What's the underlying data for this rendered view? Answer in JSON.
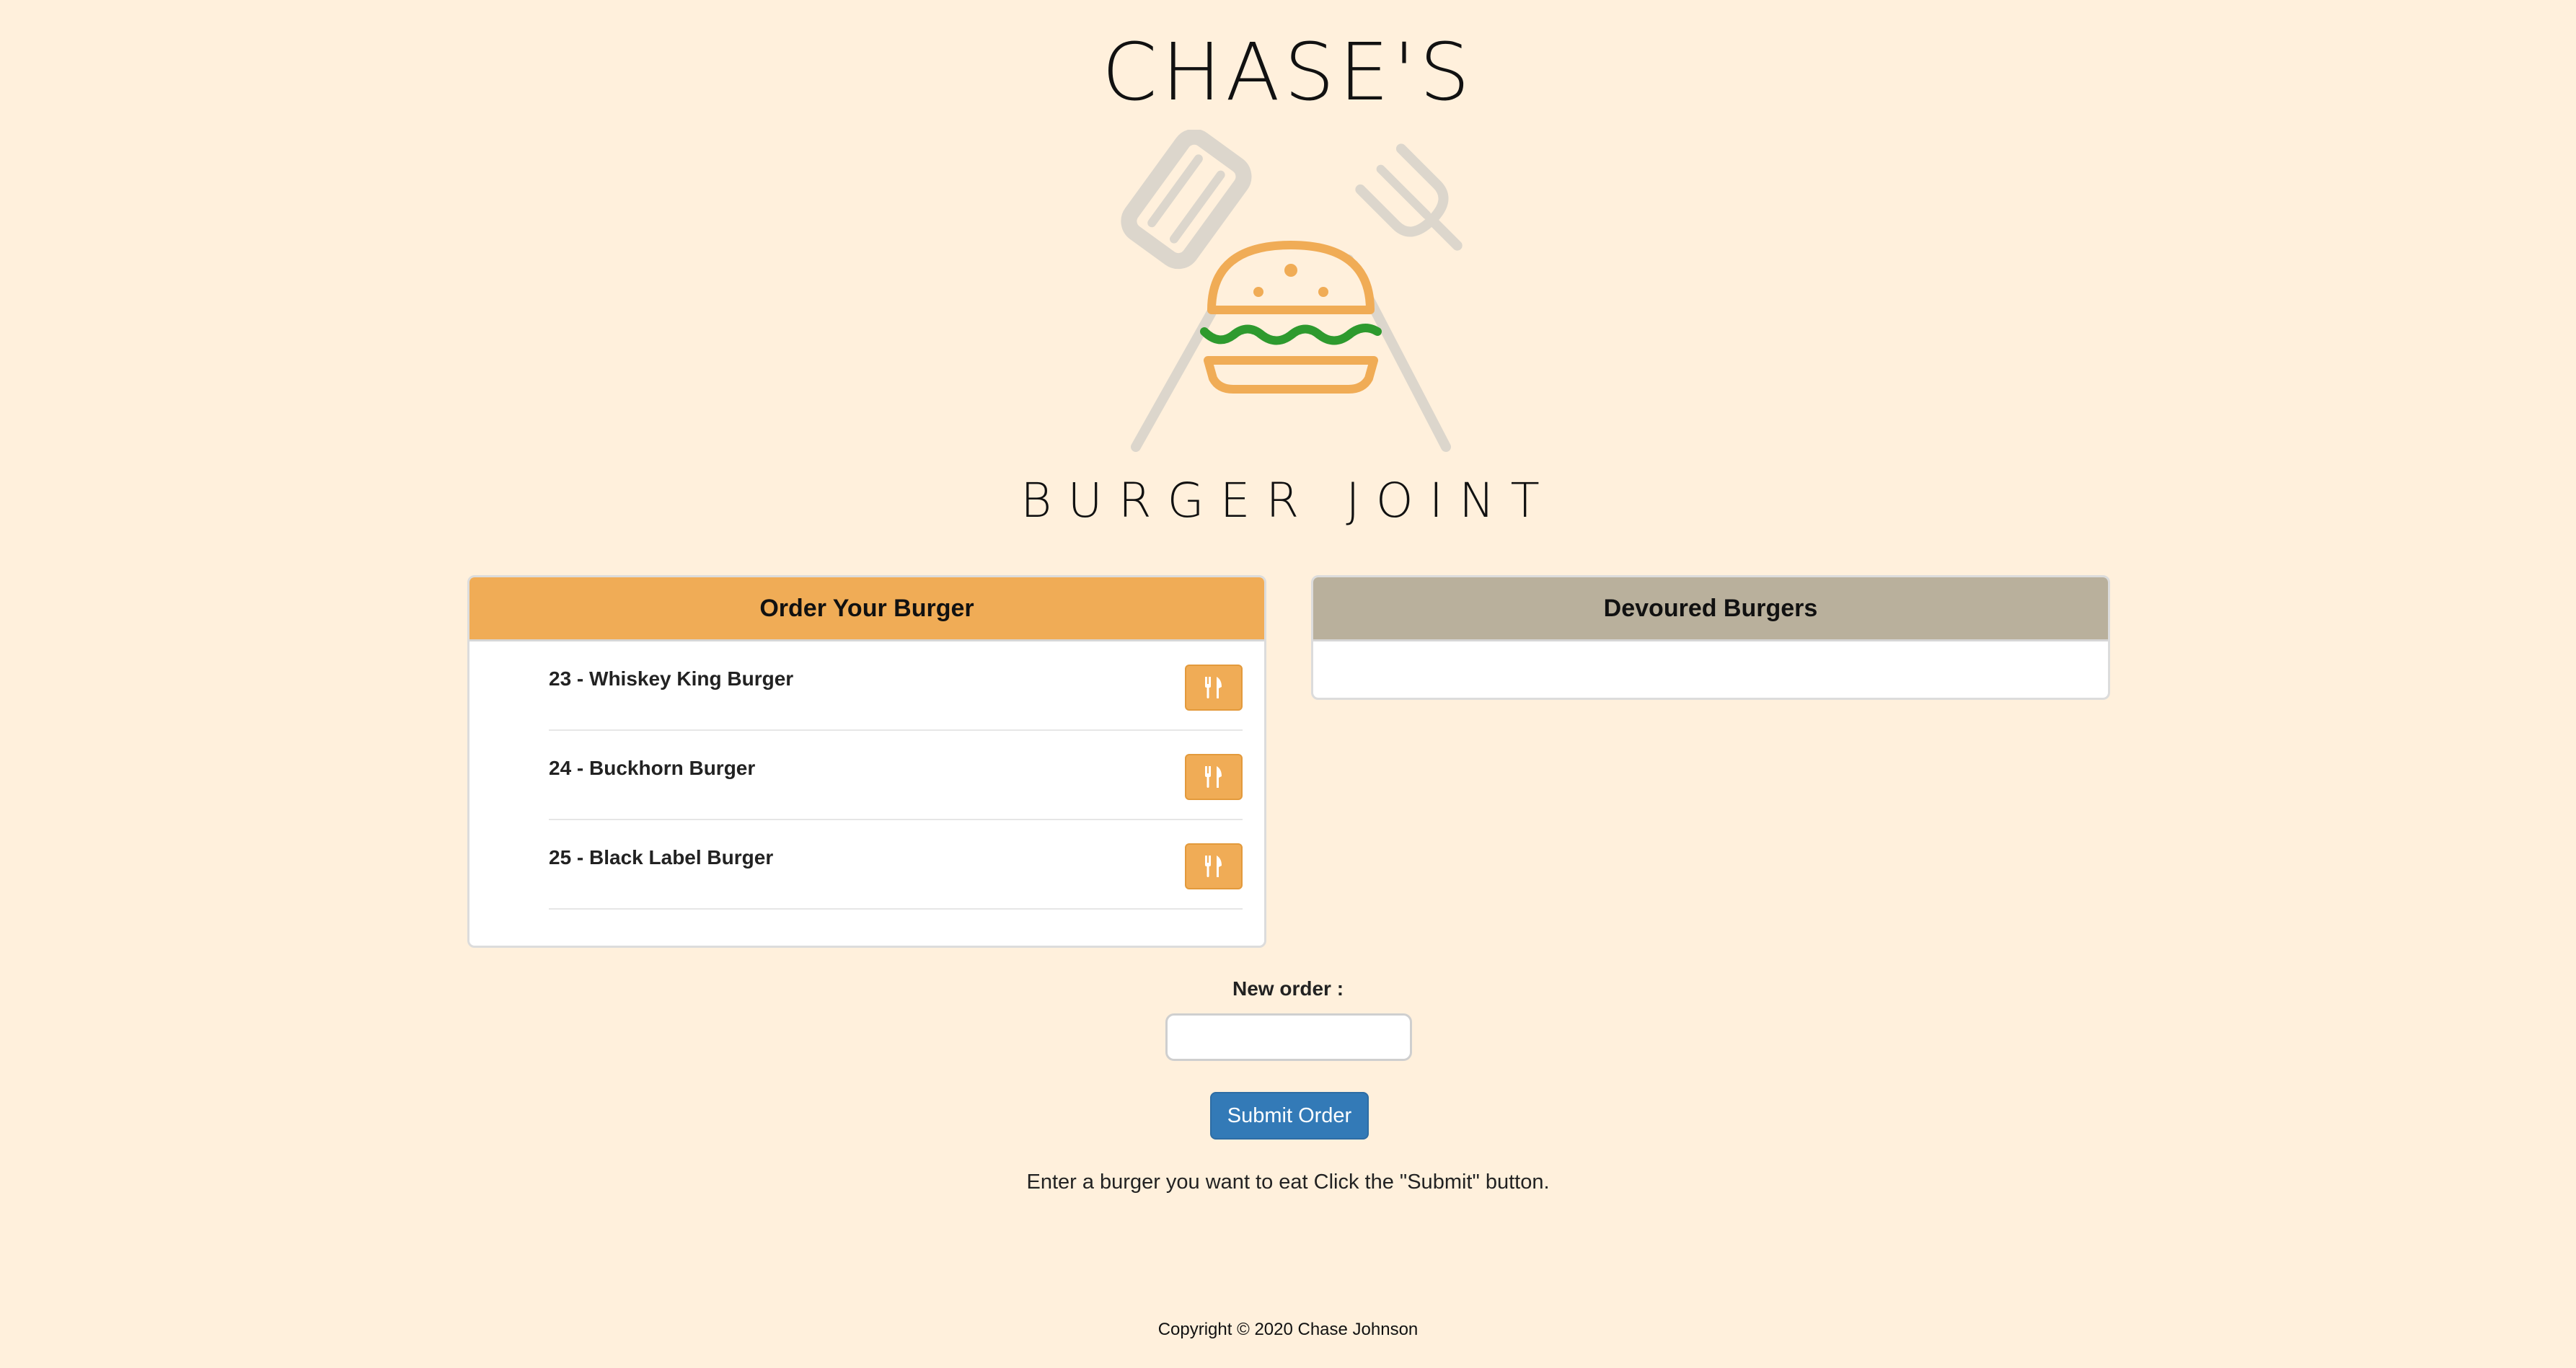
{
  "brand": {
    "top": "CHASE'S",
    "bottom": "BURGER JOINT"
  },
  "colors": {
    "background": "#fff0dc",
    "accent_orange": "#f0ac56",
    "devoured_header": "#b9b09c",
    "submit_blue": "#337ab7",
    "logo_green": "#2e9a2e"
  },
  "order_panel": {
    "title": "Order Your Burger",
    "items": [
      {
        "label": "23 - Whiskey King Burger",
        "button_icon": "utensils-icon"
      },
      {
        "label": "24 - Buckhorn Burger",
        "button_icon": "utensils-icon"
      },
      {
        "label": "25 - Black Label Burger",
        "button_icon": "utensils-icon"
      }
    ]
  },
  "devoured_panel": {
    "title": "Devoured Burgers",
    "items": []
  },
  "form": {
    "label": "New order :",
    "input_value": "",
    "input_placeholder": "",
    "submit_label": "Submit Order",
    "help_text": "Enter a burger you want to eat Click the \"Submit\" button."
  },
  "footer": {
    "copyright": "Copyright © 2020 Chase Johnson"
  }
}
